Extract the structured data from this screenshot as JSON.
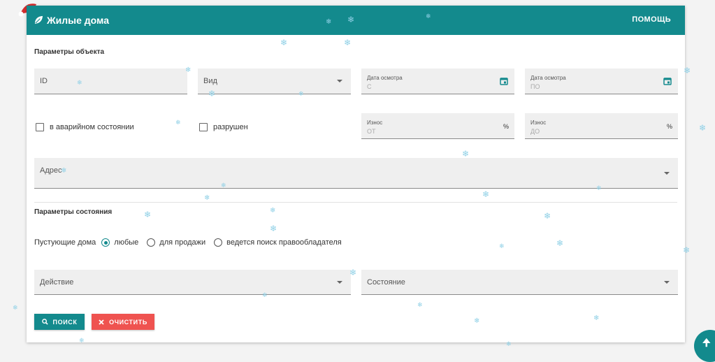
{
  "header": {
    "title": "Жилые дома",
    "help": "ПОМОЩЬ"
  },
  "object_params": {
    "title": "Параметры объекта",
    "id_label": "ID",
    "type_label": "Вид",
    "inspection_from": {
      "label": "Дата осмотра",
      "placeholder": "С"
    },
    "inspection_to": {
      "label": "Дата осмотра",
      "placeholder": "ПО"
    },
    "emergency_label": "в аварийном состоянии",
    "destroyed_label": "разрушен",
    "wear_from": {
      "label": "Износ",
      "placeholder": "ОТ",
      "unit": "%"
    },
    "wear_to": {
      "label": "Износ",
      "placeholder": "ДО",
      "unit": "%"
    },
    "address_label": "Адрес"
  },
  "state_params": {
    "title": "Параметры состояния",
    "vacant_label": "Пустующие дома",
    "vacant_options": [
      "любые",
      "для продажи",
      "ведется поиск правообладателя"
    ],
    "vacant_selected": "любые",
    "action_label": "Действие",
    "state_label": "Состояние"
  },
  "buttons": {
    "search": "ПОИСК",
    "clear": "ОЧИСТИТЬ"
  },
  "colors": {
    "accent": "#138a8d",
    "danger": "#ef5350"
  },
  "icons": [
    "leaf-icon",
    "calendar-icon",
    "search-icon",
    "close-icon",
    "arrow-up-icon",
    "snowflake-icon",
    "santa-hat-icon"
  ]
}
